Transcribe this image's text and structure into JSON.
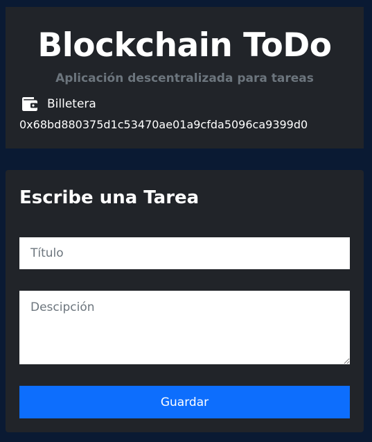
{
  "header": {
    "title": "Blockchain ToDo",
    "subtitle": "Aplicación descentralizada para tareas",
    "wallet": {
      "icon": "wallet-icon",
      "label": "Billetera",
      "address": "0x68bd880375d1c53470ae01a9cfda5096ca9399d0"
    }
  },
  "form": {
    "title": "Escribe una Tarea",
    "title_field": {
      "placeholder": "Título",
      "value": ""
    },
    "description_field": {
      "placeholder": "Descipción",
      "value": ""
    },
    "submit_label": "Guardar"
  },
  "colors": {
    "page_background": "#0a1a33",
    "card_background": "#212429",
    "muted_text": "#6c757d",
    "primary_button": "#0d6efd"
  }
}
